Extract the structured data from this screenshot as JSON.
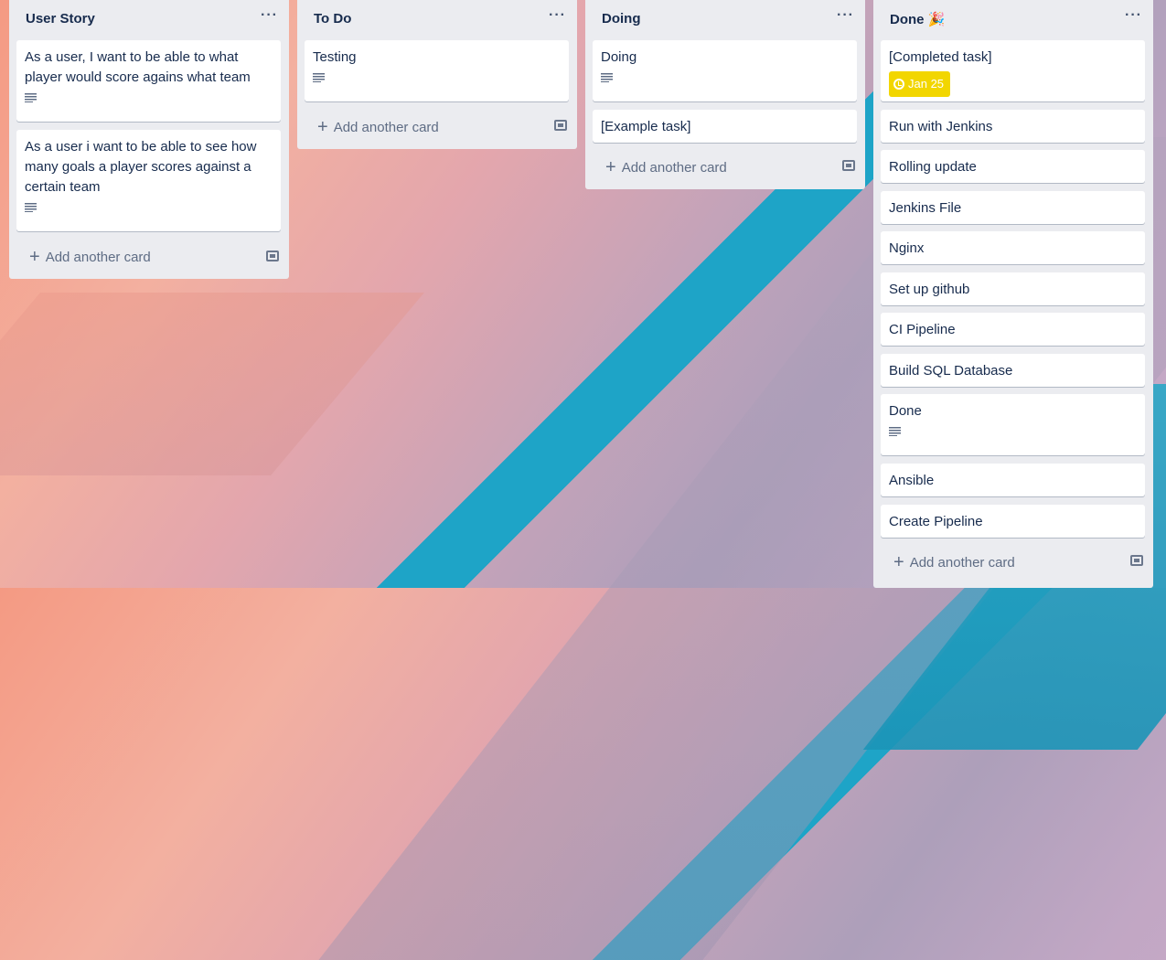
{
  "lists": [
    {
      "title": "User Story",
      "cards": [
        {
          "text": "As a user, I want to be able to what player would score agains what team",
          "has_description": true
        },
        {
          "text": "As a user i want to be able to see how many goals a player scores against a certain team",
          "has_description": true
        }
      ],
      "add_label": "Add another card"
    },
    {
      "title": "To Do",
      "cards": [
        {
          "text": "Testing",
          "has_description": true
        }
      ],
      "add_label": "Add another card"
    },
    {
      "title": "Doing",
      "cards": [
        {
          "text": "Doing",
          "has_description": true
        },
        {
          "text": "[Example task]",
          "has_description": false
        }
      ],
      "add_label": "Add another card"
    },
    {
      "title": "Done",
      "title_icon": "party-popper-icon",
      "cards": [
        {
          "text": "[Completed task]",
          "due_badge": "Jan 25",
          "due_color": "#f2d600"
        },
        {
          "text": "Run with Jenkins"
        },
        {
          "text": "Rolling update"
        },
        {
          "text": "Jenkins File"
        },
        {
          "text": "Nginx"
        },
        {
          "text": "Set up github"
        },
        {
          "text": "CI Pipeline"
        },
        {
          "text": "Build SQL Database"
        },
        {
          "text": "Done",
          "has_description": true
        },
        {
          "text": "Ansible"
        },
        {
          "text": "Create Pipeline"
        }
      ],
      "add_label": "Add another card"
    }
  ],
  "menu_glyph": "···",
  "add_glyph": "+",
  "party_glyph": "🎉"
}
